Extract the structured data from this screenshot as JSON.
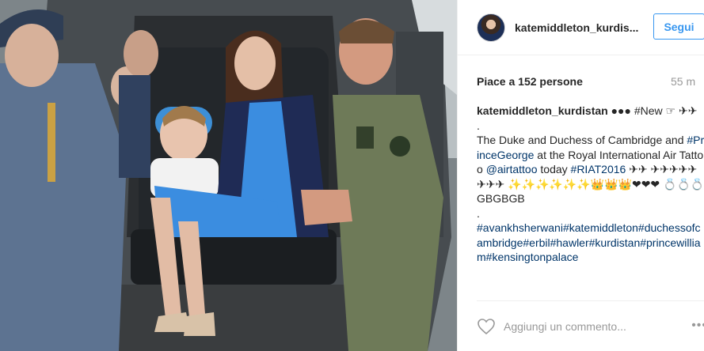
{
  "post": {
    "username": "katemiddleton_kurdis...",
    "follow_label": "Segui",
    "likes_text": "Piace a 152 persone",
    "time_text": "55 m",
    "caption": {
      "user": "katemiddleton_kurdistan",
      "line1_rest": "●●● #New ☞ ✈✈",
      "dot": ".",
      "text_a": "The Duke and Duchess of Cambridge and ",
      "tag_prince": "#PrinceGeorge",
      "text_b": " at the Royal International Air Tattoo ",
      "mention": "@airtattoo",
      "text_c": " today ",
      "tag_riat": "#RIAT2016",
      "emoji_line": " ✈✈ ✈✈✈✈✈✈✈✈ ✨✨✨✨✨✨👑👑👑❤❤❤ 💍💍💍GBGBGB",
      "dot2": ".",
      "hashtags": "#avankhsherwani#katemiddleton#duchessofcambridge#erbil#hawler#kurdistan#princewilliam#kensingtonpalace"
    },
    "comment_placeholder": "Aggiungi un commento...",
    "more_icon": "•••"
  },
  "colors": {
    "accent": "#3897f0",
    "hashtag": "#003569",
    "muted": "#999999",
    "border": "#efefef"
  },
  "icons": {
    "heart": "heart-outline-icon",
    "more": "more-options-icon"
  }
}
